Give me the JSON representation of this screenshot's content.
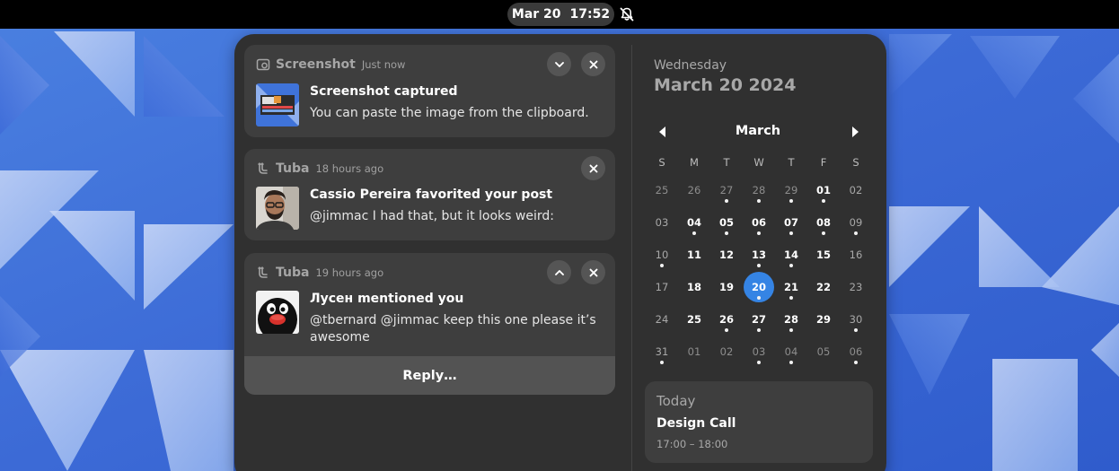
{
  "topbar": {
    "date": "Mar 20",
    "time": "17:52",
    "dnd_icon": "bell-disabled-icon"
  },
  "notifications": [
    {
      "app": "Screenshot",
      "app_icon": "screenshot-icon",
      "time": "Just now",
      "title": "Screenshot captured",
      "body": "You can paste the image from the clipboard.",
      "thumbnail": "screenshot-thumbnail",
      "buttons": [
        "expand-icon",
        "close-icon"
      ]
    },
    {
      "app": "Tuba",
      "app_icon": "tuba-icon",
      "time": "18 hours ago",
      "title": "Cassio Pereira favorited your post",
      "body": "@jimmac I had that, but it looks weird:",
      "thumbnail": "avatar-photo",
      "buttons": [
        "close-icon"
      ]
    },
    {
      "app": "Tuba",
      "app_icon": "tuba-icon",
      "time": "19 hours ago",
      "title": "Лусен mentioned you",
      "body": "@tbernard @jimmac keep this one please it’s awesome",
      "thumbnail": "penguin-avatar",
      "buttons": [
        "collapse-icon",
        "close-icon"
      ],
      "action": "Reply…"
    }
  ],
  "calendar": {
    "weekday": "Wednesday",
    "full_date": "March 20 2024",
    "month": "March",
    "day_headers": [
      "S",
      "M",
      "T",
      "W",
      "T",
      "F",
      "S"
    ],
    "weeks": [
      [
        {
          "d": "25",
          "m": "prev"
        },
        {
          "d": "26",
          "m": "prev"
        },
        {
          "d": "27",
          "m": "prev",
          "ev": true
        },
        {
          "d": "28",
          "m": "prev",
          "ev": true
        },
        {
          "d": "29",
          "m": "prev",
          "ev": true
        },
        {
          "d": "01",
          "m": "cur",
          "ev": true
        },
        {
          "d": "02",
          "m": "cur"
        }
      ],
      [
        {
          "d": "03",
          "m": "cur"
        },
        {
          "d": "04",
          "m": "cur",
          "ev": true
        },
        {
          "d": "05",
          "m": "cur",
          "ev": true
        },
        {
          "d": "06",
          "m": "cur",
          "ev": true
        },
        {
          "d": "07",
          "m": "cur",
          "ev": true
        },
        {
          "d": "08",
          "m": "cur",
          "ev": true
        },
        {
          "d": "09",
          "m": "cur",
          "ev": true
        }
      ],
      [
        {
          "d": "10",
          "m": "cur",
          "ev": true
        },
        {
          "d": "11",
          "m": "cur"
        },
        {
          "d": "12",
          "m": "cur"
        },
        {
          "d": "13",
          "m": "cur",
          "ev": true
        },
        {
          "d": "14",
          "m": "cur",
          "ev": true
        },
        {
          "d": "15",
          "m": "cur"
        },
        {
          "d": "16",
          "m": "cur"
        }
      ],
      [
        {
          "d": "17",
          "m": "cur"
        },
        {
          "d": "18",
          "m": "cur"
        },
        {
          "d": "19",
          "m": "cur"
        },
        {
          "d": "20",
          "m": "cur",
          "ev": true,
          "today": true
        },
        {
          "d": "21",
          "m": "cur",
          "ev": true
        },
        {
          "d": "22",
          "m": "cur"
        },
        {
          "d": "23",
          "m": "cur"
        }
      ],
      [
        {
          "d": "24",
          "m": "cur"
        },
        {
          "d": "25",
          "m": "cur"
        },
        {
          "d": "26",
          "m": "cur",
          "ev": true
        },
        {
          "d": "27",
          "m": "cur",
          "ev": true
        },
        {
          "d": "28",
          "m": "cur",
          "ev": true
        },
        {
          "d": "29",
          "m": "cur"
        },
        {
          "d": "30",
          "m": "cur",
          "ev": true
        }
      ],
      [
        {
          "d": "31",
          "m": "cur",
          "ev": true
        },
        {
          "d": "01",
          "m": "next"
        },
        {
          "d": "02",
          "m": "next"
        },
        {
          "d": "03",
          "m": "next",
          "ev": true
        },
        {
          "d": "04",
          "m": "next",
          "ev": true
        },
        {
          "d": "05",
          "m": "next"
        },
        {
          "d": "06",
          "m": "next",
          "ev": true
        }
      ]
    ]
  },
  "events": {
    "section": "Today",
    "items": [
      {
        "title": "Design Call",
        "time": "17:00 – 18:00"
      }
    ]
  },
  "colors": {
    "accent": "#3584e4",
    "panel": "#303030",
    "card": "#3e3e3e",
    "wallpaper": "#3f6fd8"
  }
}
